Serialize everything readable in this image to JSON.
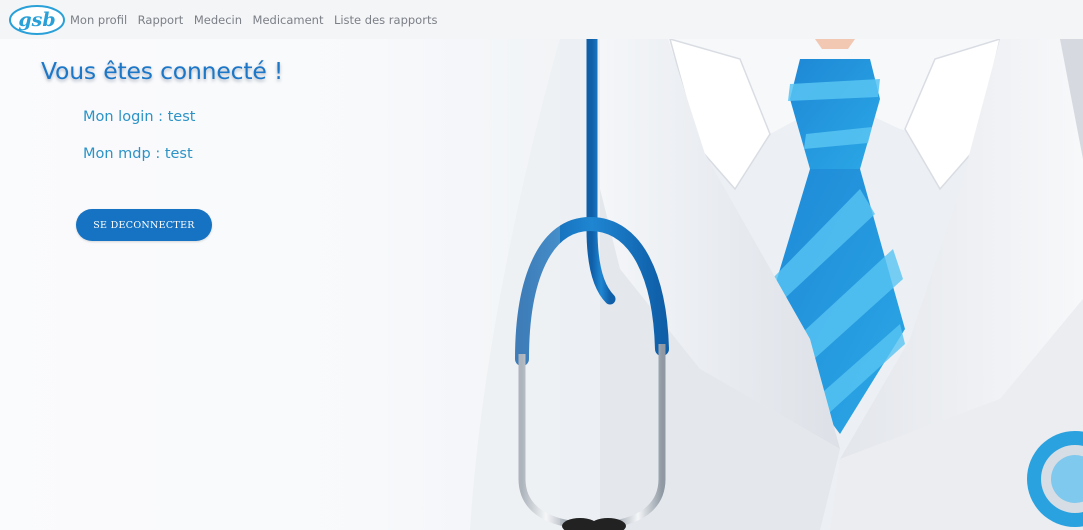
{
  "navbar": {
    "logo_text": "gsb",
    "links": [
      "Mon profil",
      "Rapport",
      "Medecin",
      "Medicament",
      "Liste des rapports"
    ]
  },
  "main": {
    "title": "Vous êtes connecté !",
    "login_line": "Mon login : test",
    "password_line": "Mon mdp : test",
    "logout_label": "SE DECONNECTER"
  },
  "colors": {
    "accent_blue": "#1672c2",
    "title_blue": "#1c77c8",
    "info_text": "#2c93c6",
    "tie_blue": "#2aa2e0",
    "nav_text": "#7b7f86"
  },
  "icons": {
    "logo": "gsb-logo",
    "illustration": "doctor-coat-stethoscope-illustration"
  }
}
